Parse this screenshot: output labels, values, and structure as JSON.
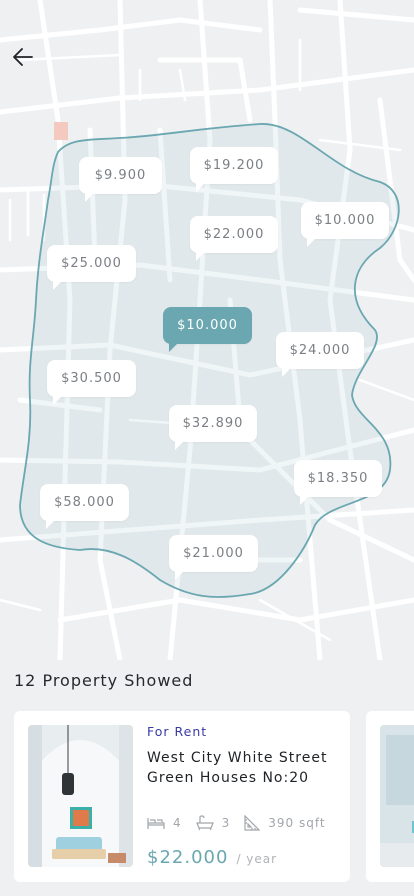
{
  "map": {
    "pins": [
      {
        "label": "$9.900",
        "active": false
      },
      {
        "label": "$19.200",
        "active": false
      },
      {
        "label": "$10.000",
        "active": false
      },
      {
        "label": "$22.000",
        "active": false
      },
      {
        "label": "$25.000",
        "active": false
      },
      {
        "label": "$10.000",
        "active": true
      },
      {
        "label": "$24.000",
        "active": false
      },
      {
        "label": "$30.500",
        "active": false
      },
      {
        "label": "$32.890",
        "active": false
      },
      {
        "label": "$18.350",
        "active": false
      },
      {
        "label": "$58.000",
        "active": false
      },
      {
        "label": "$21.000",
        "active": false
      }
    ],
    "area_color": "#6aa7b0"
  },
  "results": {
    "count_label": "12 Property Showed"
  },
  "card": {
    "tag": "For Rent",
    "title": "West City White Street Green Houses No:20",
    "beds": "4",
    "baths": "3",
    "area": "390 sqft",
    "price": "$22.000",
    "period": "/ year"
  },
  "icons": {
    "back": "arrow-left-icon",
    "bed": "bed-icon",
    "bath": "bathtub-icon",
    "area": "ruler-triangle-icon"
  },
  "colors": {
    "accent": "#6aa7b0",
    "tag": "#3a3aa8",
    "background": "#eef0f2"
  }
}
